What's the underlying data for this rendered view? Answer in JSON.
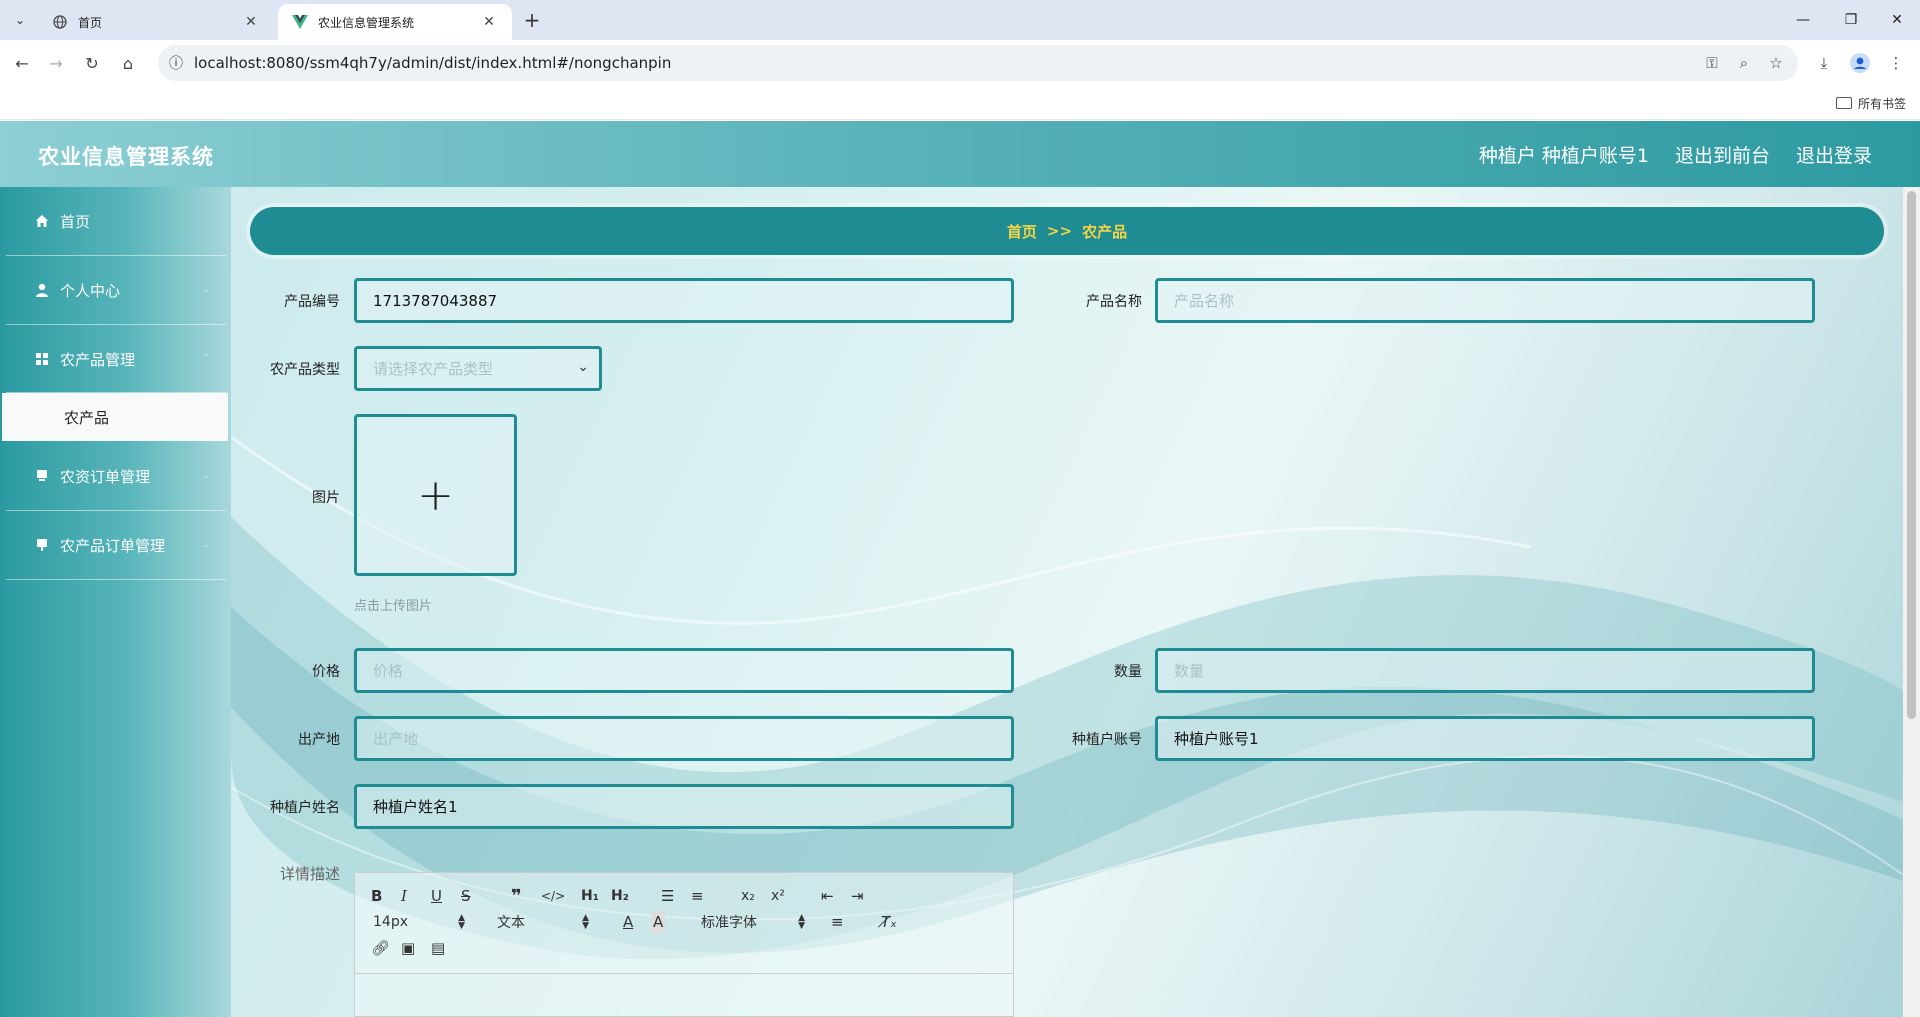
{
  "browser": {
    "tabs": [
      {
        "title": "首页",
        "active": false
      },
      {
        "title": "农业信息管理系统",
        "active": true
      }
    ],
    "url": "localhost:8080/ssm4qh7y/admin/dist/index.html#/nongchanpin",
    "bookmarks_label": "所有书签"
  },
  "header": {
    "title": "农业信息管理系统",
    "user": "种植户 种植户账号1",
    "front_link": "退出到前台",
    "logout": "退出登录"
  },
  "sidebar": {
    "items": [
      {
        "label": "首页",
        "icon": "home-icon"
      },
      {
        "label": "个人中心",
        "icon": "user-icon"
      },
      {
        "label": "农产品管理",
        "icon": "grid-icon"
      },
      {
        "label": "农资订单管理",
        "icon": "monitor-icon"
      },
      {
        "label": "农产品订单管理",
        "icon": "monitor-icon"
      }
    ],
    "submenu": "农产品"
  },
  "breadcrumb": {
    "home": "首页",
    "sep": ">>",
    "current": "农产品"
  },
  "form": {
    "product_no": {
      "label": "产品编号",
      "value": "1713787043887"
    },
    "product_name": {
      "label": "产品名称",
      "placeholder": "产品名称"
    },
    "category": {
      "label": "农产品类型",
      "placeholder": "请选择农产品类型"
    },
    "image": {
      "label": "图片",
      "tip": "点击上传图片"
    },
    "price": {
      "label": "价格",
      "placeholder": "价格"
    },
    "quantity": {
      "label": "数量",
      "placeholder": "数量"
    },
    "origin": {
      "label": "出产地",
      "placeholder": "出产地"
    },
    "grower_account": {
      "label": "种植户账号",
      "value": "种植户账号1"
    },
    "grower_name": {
      "label": "种植户姓名",
      "value": "种植户姓名1"
    },
    "detail": {
      "label": "详情描述"
    }
  },
  "editor": {
    "font_size": "14px",
    "text_style": "文本",
    "font_family": "标准字体"
  },
  "colors": {
    "accent": "#1f8b92",
    "breadcrumb_text": "#f5d547",
    "header_start": "#8ccfd4",
    "header_end": "#2d9aa1"
  }
}
